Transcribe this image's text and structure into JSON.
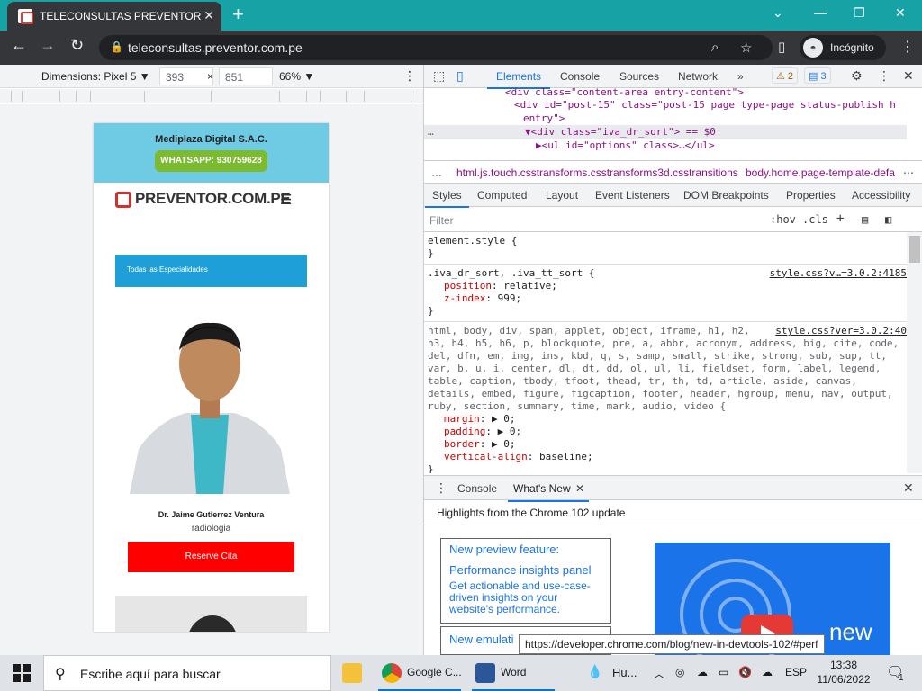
{
  "browser": {
    "tab_title": "TELECONSULTAS PREVENTOR – T",
    "url": "teleconsultas.preventor.com.pe",
    "incognito_label": "Incógnito"
  },
  "device_toolbar": {
    "dimensions_label": "Dimensions: Pixel 5 ▼",
    "width": "393",
    "height": "851",
    "times": "×",
    "zoom": "66% ▼"
  },
  "page": {
    "company": "Mediplaza Digital S.A.C.",
    "whatsapp": "WHATSAPP: 930759628",
    "logo_text": "PREVENTOR.COM.PE",
    "specialties": "Todas las Especialidades",
    "doctor_name": "Dr. Jaime Gutierrez Ventura",
    "specialty": "radiologia",
    "cta": "Reserve Cita"
  },
  "devtools": {
    "tabs": [
      "Elements",
      "Console",
      "Sources",
      "Network",
      "»"
    ],
    "warnings": "2",
    "messages": "3",
    "dom_lines": [
      "<div class=\"content-area entry-content\">",
      "<div id=\"post-15\" class=\"post-15 page type-page status-publish h",
      "entry\">",
      "▼<div class=\"iva_dr_sort\"> == $0",
      "▶<ul id=\"options\" class>…</ul>"
    ],
    "breadcrumb_1": "html.js.touch.csstransforms.csstransforms3d.csstransitions",
    "breadcrumb_2": "body.home.page-template-defa",
    "style_tabs": [
      "Styles",
      "Computed",
      "Layout",
      "Event Listeners",
      "DOM Breakpoints",
      "Properties",
      "Accessibility"
    ],
    "filter_placeholder": "Filter",
    "filter_hov": ":hov",
    "filter_cls": ".cls",
    "rules": {
      "element_style": "element.style {",
      "close": "}",
      "sel1": ".iva_dr_sort, .iva_tt_sort {",
      "src1": "style.css?v…=3.0.2:4185",
      "p1": "position",
      "v1": "relative;",
      "p2": "z-index",
      "v2": "999;",
      "reset_selectors": [
        "html, body, div, span, applet, object, iframe, h1, h2,",
        "h3, h4, h5, h6, p, blockquote, pre, a, abbr, acronym, address, big, cite, code,",
        "del, dfn, em, img, ins, kbd, q, s, samp, small, strike, strong, sub, sup, tt,",
        "var, b, u, i, center, dl, dt, dd, ol, ul, li, fieldset, form, label, legend,",
        "table, caption, tbody, tfoot, thead, tr, th, td, article, aside, canvas,",
        "details, embed, figure, figcaption, footer, header, hgroup, menu, nav, output,",
        "ruby, section, summary, time, mark, audio, video {"
      ],
      "src2": "style.css?ver=3.0.2:40",
      "p3": "margin",
      "v3": "▶ 0;",
      "p4": "padding",
      "v4": "▶ 0;",
      "p5": "border",
      "v5": "▶ 0;",
      "p6": "vertical-align",
      "v6": "baseline;"
    },
    "drawer_tabs": [
      "Console",
      "What's New"
    ],
    "highlights": "Highlights from the Chrome 102 update",
    "card_title": "New preview feature:",
    "card_subtitle": "Performance insights panel",
    "card_body": "Get actionable and use-case-driven insights on your website's performance.",
    "card2": "New emulati",
    "promo_text": "new",
    "tooltip": "https://developer.chrome.com/blog/new-in-devtools-102/#perf"
  },
  "taskbar": {
    "search_placeholder": "Escribe aquí para buscar",
    "apps": [
      "Google C...",
      "Word"
    ],
    "weather": "Hu...",
    "lang": "ESP",
    "time": "13:38",
    "date": "11/06/2022",
    "notif": "1"
  },
  "colors": {
    "browser_title_bar": "#17a2a6",
    "banner": "#6fcbe3",
    "whatsapp": "#7cba2f",
    "specialties": "#1e9fd8",
    "cta": "#ff0000"
  }
}
